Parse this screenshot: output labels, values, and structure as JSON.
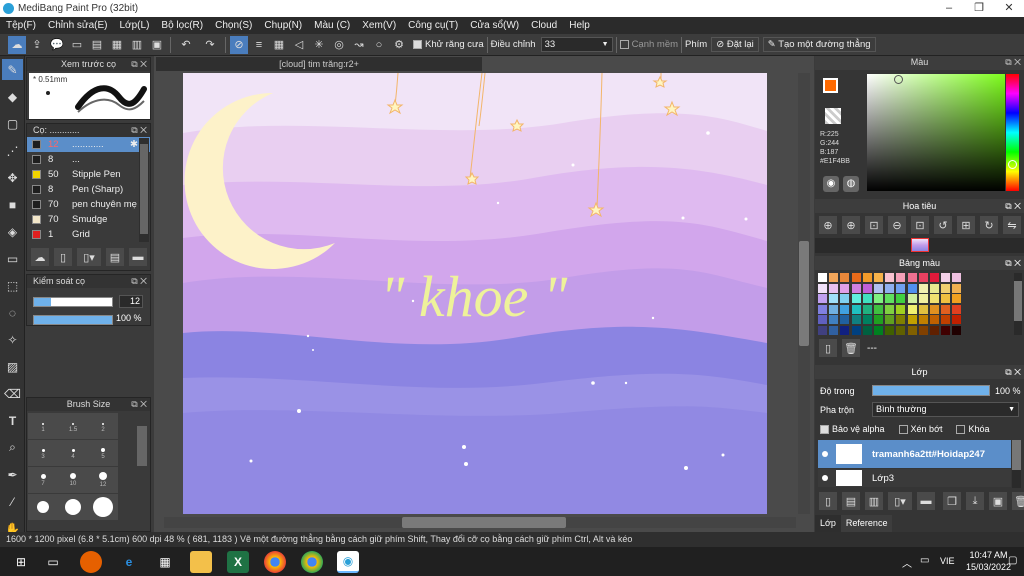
{
  "window": {
    "title": "MediBang Paint Pro (32bit)"
  },
  "menu": [
    "Tệp(F)",
    "Chỉnh sửa(E)",
    "Lớp(L)",
    "Bộ lọc(R)",
    "Chọn(S)",
    "Chụp(N)",
    "Màu (C)",
    "Xem(V)",
    "Công cụ(T)",
    "Cửa sổ(W)",
    "Cloud",
    "Help"
  ],
  "toolbar": {
    "antialias_label": "Khử răng cưa",
    "adjust_label": "Điều chỉnh",
    "adjust_value": "33",
    "edge_label": "Cạnh mềm",
    "key_label": "Phím",
    "reset_label": "Đặt lại",
    "line_label": "Tạo một đường thẳng"
  },
  "brush_preview": {
    "title": "Xem trước cọ",
    "size": "0.51mm"
  },
  "brush_panel": {
    "title": "Cọ: ............",
    "items": [
      {
        "num": "12",
        "name": "............",
        "color": "#1e1e1e",
        "selected": true
      },
      {
        "num": "8",
        "name": "...",
        "color": "#1e1e1e"
      },
      {
        "num": "50",
        "name": "Stipple Pen",
        "color": "#f2d400"
      },
      {
        "num": "8",
        "name": "Pen (Sharp)",
        "color": "#1e1e1e"
      },
      {
        "num": "70",
        "name": "pen chuyên mẹ",
        "color": "#1e1e1e"
      },
      {
        "num": "70",
        "name": "Smudge",
        "color": "#f2e6c8"
      },
      {
        "num": "1",
        "name": "Grid",
        "color": "#e02020"
      }
    ]
  },
  "brush_control": {
    "title": "Kiểm soát cọ",
    "size_value": "12",
    "opacity_value": "100 %"
  },
  "brush_size": {
    "title": "Brush Size",
    "labels": [
      "1",
      "1.5",
      "2",
      "3",
      "4",
      "5",
      "7",
      "10",
      "12"
    ]
  },
  "document": {
    "tab_title": "[cloud] tim trăng:r2+",
    "artwork_text": "\" khoe \""
  },
  "color_panel": {
    "title": "Màu",
    "r": "R:225",
    "g": "G:244",
    "b": "B:187",
    "hex": "#E1F4BB",
    "primary": "#ff6a00",
    "secondary": "#f4e9a8"
  },
  "navigator": {
    "title": "Hoa tiêu"
  },
  "palette": {
    "title": "Bảng màu",
    "label": "---"
  },
  "layers": {
    "title": "Lớp",
    "opacity_label": "Độ trong",
    "opacity_value": "100 %",
    "blend_label": "Pha trộn",
    "blend_value": "Bình thường",
    "protect_alpha": "Bảo vệ alpha",
    "clip": "Xén bớt",
    "lock": "Khóa",
    "items": [
      {
        "name": "tramanh6a2tt#Hoidap247",
        "selected": true
      },
      {
        "name": "Lớp3",
        "selected": false
      }
    ],
    "tabs": [
      "Lớp",
      "Reference"
    ]
  },
  "status": {
    "text": "1600 * 1200 pixel   (6.8 * 5.1cm)  600 dpi  48 %   ( 681, 1183 )  Vẽ một đường thẳng bằng cách giữ phím Shift, Thay đổi cỡ cọ bằng cách giữ phím Ctrl, Alt và kéo"
  },
  "taskbar": {
    "time": "10:47 AM",
    "date": "15/03/2022",
    "lang": "VIE"
  }
}
